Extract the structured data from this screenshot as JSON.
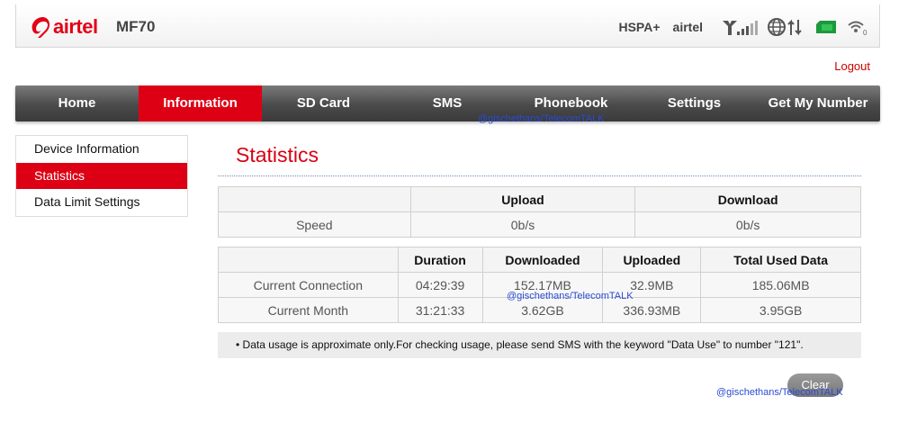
{
  "header": {
    "brand": "airtel",
    "model": "MF70",
    "network_type": "HSPA+",
    "carrier": "airtel",
    "icons": [
      "signal-bars-icon",
      "globe-data-icon",
      "sim-card-icon",
      "wifi-icon"
    ],
    "wifi_clients": "0"
  },
  "logout_label": "Logout",
  "nav": {
    "items": [
      {
        "label": "Home"
      },
      {
        "label": "Information"
      },
      {
        "label": "SD Card"
      },
      {
        "label": "SMS"
      },
      {
        "label": "Phonebook"
      },
      {
        "label": "Settings"
      },
      {
        "label": "Get My Number"
      }
    ],
    "active_index": 1
  },
  "sidebar": {
    "items": [
      {
        "label": "Device Information"
      },
      {
        "label": "Statistics"
      },
      {
        "label": "Data Limit Settings"
      }
    ],
    "active_index": 1
  },
  "page_title": "Statistics",
  "speed_table": {
    "headers": [
      "",
      "Upload",
      "Download"
    ],
    "rows": [
      {
        "label": "Speed",
        "upload": "0b/s",
        "download": "0b/s"
      }
    ]
  },
  "usage_table": {
    "headers": [
      "",
      "Duration",
      "Downloaded",
      "Uploaded",
      "Total Used Data"
    ],
    "rows": [
      {
        "label": "Current Connection",
        "duration": "04:29:39",
        "downloaded": "152.17MB",
        "uploaded": "32.9MB",
        "total": "185.06MB"
      },
      {
        "label": "Current Month",
        "duration": "31:21:33",
        "downloaded": "3.62GB",
        "uploaded": "336.93MB",
        "total": "3.95GB"
      }
    ]
  },
  "note": "• Data usage is approximate only.For checking usage,   please send SMS with the keyword \"Data Use\" to number \"121\".",
  "clear_label": "Clear",
  "watermark": "@gischethans/TelecomTALK",
  "colors": {
    "accent": "#dd0014",
    "nav_dark": "#4a4a4a",
    "watermark": "#2a4bd4"
  }
}
